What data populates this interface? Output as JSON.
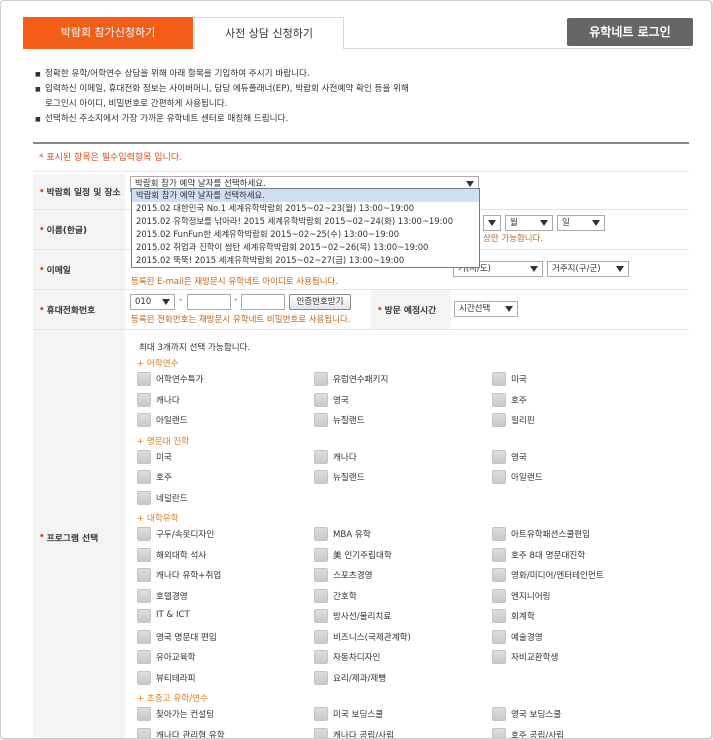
{
  "tabs": {
    "active": "박람회 참가신청하기",
    "inactive": "사전 상담 신청하기"
  },
  "login_button": "유학네트 로그인",
  "notices": [
    "정확한 유학/어학연수 상담을 위해 아래 항목을 기입하여 주시기 바랍니다.",
    "입력하신 이메일, 휴대전화 정보는 사이버머니, 담당 에듀플래너(EP), 박람회 사전예약 확인 등을 위해",
    "로그인시 아이디, 비밀번호로 간편하게 사용됩니다.",
    "선택하신 주소지에서 가장 가까운 유학네트 센터로 매칭해 드립니다."
  ],
  "required_note": "* 표시된 항목은 필수입력항목 입니다.",
  "labels": {
    "schedule": "박람회 일정 및 장소",
    "name": "이름(한글)",
    "email": "이메일",
    "phone": "휴대전화번호",
    "visit_time": "방문 예정시간",
    "program": "프로그램 선택"
  },
  "schedule_select": "박람회 참가 예약 날자를 선택하세요.",
  "schedule_options": [
    "박람회 참가 예약 날자를 선택하세요.",
    "2015.02 대한민국 No.1 세계유학박람회 2015~02~23(월) 13:00~19:00",
    "2015.02 유학정보를 낚아라! 2015 세계유학박람회 2015~02~24(화) 13:00~19:00",
    "2015.02 FunFun한 세계유학박람회 2015~02~25(수) 13:00~19:00",
    "2015.02 취업과 진학이 쌈탄 세계유학박람회 2015~02~26(목) 13:00~19:00",
    "2015.02 뚝뚝! 2015 세계유학박람회 2015~02~27(금) 13:00~19:00"
  ],
  "birth": {
    "month": "월",
    "day": "일"
  },
  "name_hint": "상만 가능합니다.",
  "email": {
    "city_select": "거(시/도)",
    "district_select": "거주지(구/군)",
    "hint": "등록된 E-mail은 재방문시 유학네트 아이디로 사용됩니다."
  },
  "phone": {
    "prefix": "010",
    "verify_button": "인증번호받기",
    "hint": "등록된 전화번호는 재방문시 유학네트 비밀번호로 사용됩니다."
  },
  "visit_time_select": "시간선택",
  "program": {
    "title": "최대 3개까지 선택 가능합니다.",
    "categories": [
      {
        "name": "+ 어학연수",
        "items": [
          "어학연수특가",
          "유럽연수패키지",
          "미국",
          "캐나다",
          "영국",
          "호주",
          "아일랜드",
          "뉴질랜드",
          "필리핀"
        ]
      },
      {
        "name": "+ 명문대 진학",
        "items": [
          "미국",
          "캐나다",
          "영국",
          "호주",
          "뉴질랜드",
          "아일랜드",
          "네덜란드"
        ]
      },
      {
        "name": "+ 대학유학",
        "items": [
          "구두/속옷디자인",
          "MBA 유학",
          "아트유학패션스쿨편입",
          "해외대학 석사",
          "美 인기주립대학",
          "호주 8대 명문대진학",
          "캐나다 유학+취업",
          "스포츠경영",
          "영화/미디어/엔터테인먼트",
          "호텔경영",
          "간호학",
          "엔지니어링",
          "IT & ICT",
          "방사선/물리치료",
          "회계학",
          "영국 명문대 편입",
          "비즈니스(국제관계학)",
          "예술경영",
          "유아교육학",
          "자동차디자인",
          "자비교환학생",
          "뷰티테라피",
          "요리/제과/제빵"
        ]
      },
      {
        "name": "+ 초중고 유학/연수",
        "items": [
          "찾아가는 컨설팅",
          "미국 보딩스쿨",
          "영국 보딩스쿨",
          "캐나다 관리형 유학",
          "캐나다 공립/사립",
          "호주 공립/사립"
        ]
      }
    ]
  }
}
